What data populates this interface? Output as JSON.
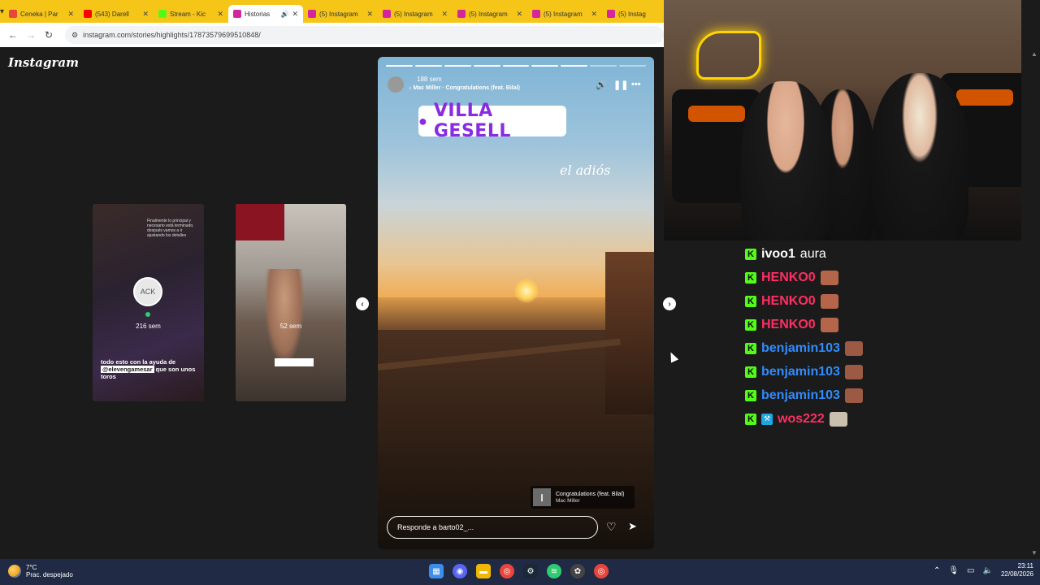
{
  "browser": {
    "tabs": [
      {
        "label": "Ceneka | Par",
        "color": "#e8453c",
        "active": false
      },
      {
        "label": "(543) Darell",
        "color": "#ff0000",
        "active": false
      },
      {
        "label": "Stream - Kic",
        "color": "#53fc18",
        "active": false
      },
      {
        "label": "Historias",
        "color": "#d6249f",
        "active": true
      },
      {
        "label": "(5) Instagram",
        "color": "#d6249f",
        "active": false
      },
      {
        "label": "(5) Instagram",
        "color": "#d6249f",
        "active": false
      },
      {
        "label": "(5) Instagram",
        "color": "#d6249f",
        "active": false
      },
      {
        "label": "(5) Instagram",
        "color": "#d6249f",
        "active": false
      },
      {
        "label": "(5) Instag",
        "color": "#d6249f",
        "active": false
      }
    ],
    "url": "instagram.com/stories/highlights/17873579699510848/"
  },
  "instagram": {
    "logo": "Instagram",
    "thumbnails": [
      {
        "time": "216 sem",
        "avatar_text": "ACK",
        "note": "Finalmente lo principal y necesario está terminado, después vamos a ir ajustando los detalles",
        "caption_pre": "todo esto con la ayuda de",
        "mention": "@elevengamesar",
        "caption_post": "que son unos toros"
      },
      {
        "time": "52 sem"
      }
    ],
    "story": {
      "time": "188 sem",
      "music": "Mac Miller · Congratulations (feat. Bilal)",
      "location": "VILLA GESELL",
      "handwritten": "el adiós",
      "music_sticker": {
        "title": "Congratulations (feat. Bilal)",
        "artist": "Mac Miller"
      },
      "reply_placeholder": "Responde a barto02_...",
      "progress_done": 7,
      "progress_total": 9
    }
  },
  "chat": {
    "messages": [
      {
        "user": "ivoo1",
        "color": "#ffffff",
        "text": "aura",
        "emote": null,
        "mod": false
      },
      {
        "user": "HENKO0",
        "color": "#ff2e63",
        "text": "",
        "emote": "#b5664a",
        "mod": false
      },
      {
        "user": "HENKO0",
        "color": "#ff2e63",
        "text": "",
        "emote": "#b5664a",
        "mod": false
      },
      {
        "user": "HENKO0",
        "color": "#ff2e63",
        "text": "",
        "emote": "#b5664a",
        "mod": false
      },
      {
        "user": "benjamin103",
        "color": "#2f8cff",
        "text": "",
        "emote": "#9c5a44",
        "mod": false
      },
      {
        "user": "benjamin103",
        "color": "#2f8cff",
        "text": "",
        "emote": "#9c5a44",
        "mod": false
      },
      {
        "user": "benjamin103",
        "color": "#2f8cff",
        "text": "",
        "emote": "#9c5a44",
        "mod": false
      },
      {
        "user": "wos222",
        "color": "#ff2e63",
        "text": "",
        "emote": "#cbbfae",
        "mod": true
      }
    ]
  },
  "taskbar": {
    "temp": "7°C",
    "weather": "Prac. despejado",
    "time": "23:11",
    "date": "22/08/2026"
  }
}
